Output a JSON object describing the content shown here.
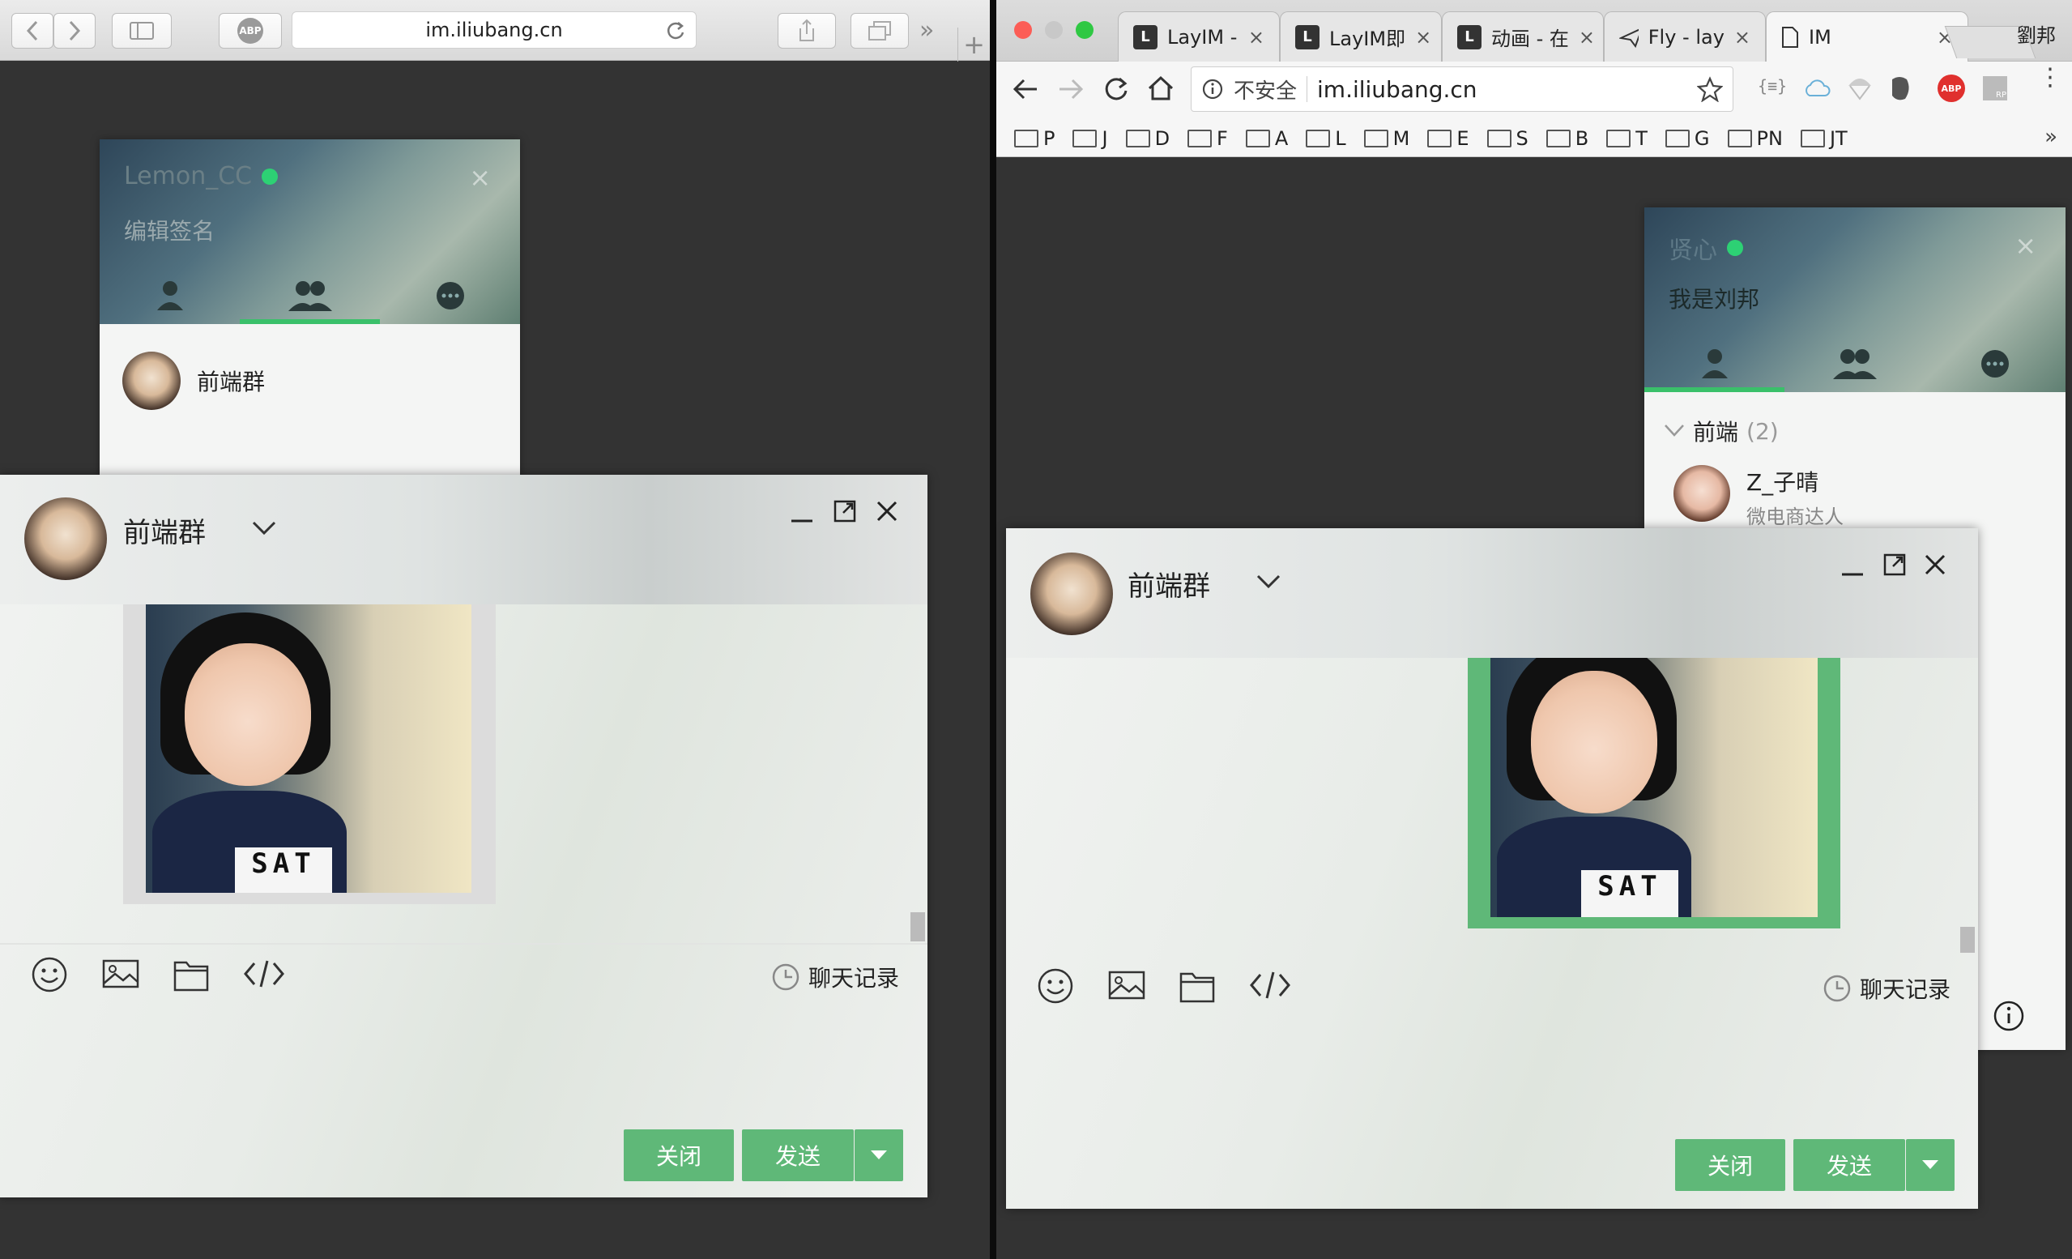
{
  "left_browser": {
    "url": "im.iliubang.cn",
    "adblock_label": "ABP"
  },
  "right_browser": {
    "tabs": [
      {
        "label": "LayIM -",
        "icon": "layui-favicon"
      },
      {
        "label": "LayIM即",
        "icon": "layui-favicon"
      },
      {
        "label": "动画 - 在",
        "icon": "layui-favicon"
      },
      {
        "label": "Fly - lay",
        "icon": "paper-plane-favicon"
      },
      {
        "label": "IM",
        "icon": "page-favicon"
      }
    ],
    "profile_name": "劉邦",
    "security_label": "不安全",
    "url": "im.iliubang.cn",
    "bookmarks": [
      "P",
      "J",
      "D",
      "F",
      "A",
      "L",
      "M",
      "E",
      "S",
      "B",
      "T",
      "G",
      "PN",
      "JT"
    ],
    "overflow": "»",
    "abp_label": "ABP",
    "rp_label": "RP"
  },
  "left_panel": {
    "username": "Lemon_CC",
    "signature": "编辑签名",
    "group_name": "前端群"
  },
  "right_panel": {
    "username": "贤心",
    "signature": "我是刘邦",
    "group_header": "前端",
    "group_count": "(2)",
    "friend_name": "Z_子晴",
    "friend_sign": "微电商达人"
  },
  "left_chat": {
    "title": "前端群",
    "history_label": "聊天记录",
    "close_label": "关闭",
    "send_label": "发送",
    "shirt_text": "SAT"
  },
  "right_chat": {
    "title": "前端群",
    "history_label": "聊天记录",
    "close_label": "关闭",
    "send_label": "发送",
    "shirt_text": "SAT"
  },
  "colors": {
    "accent_green": "#5fb878",
    "online_dot": "#2dd174",
    "selected_border": "#5fb878"
  }
}
